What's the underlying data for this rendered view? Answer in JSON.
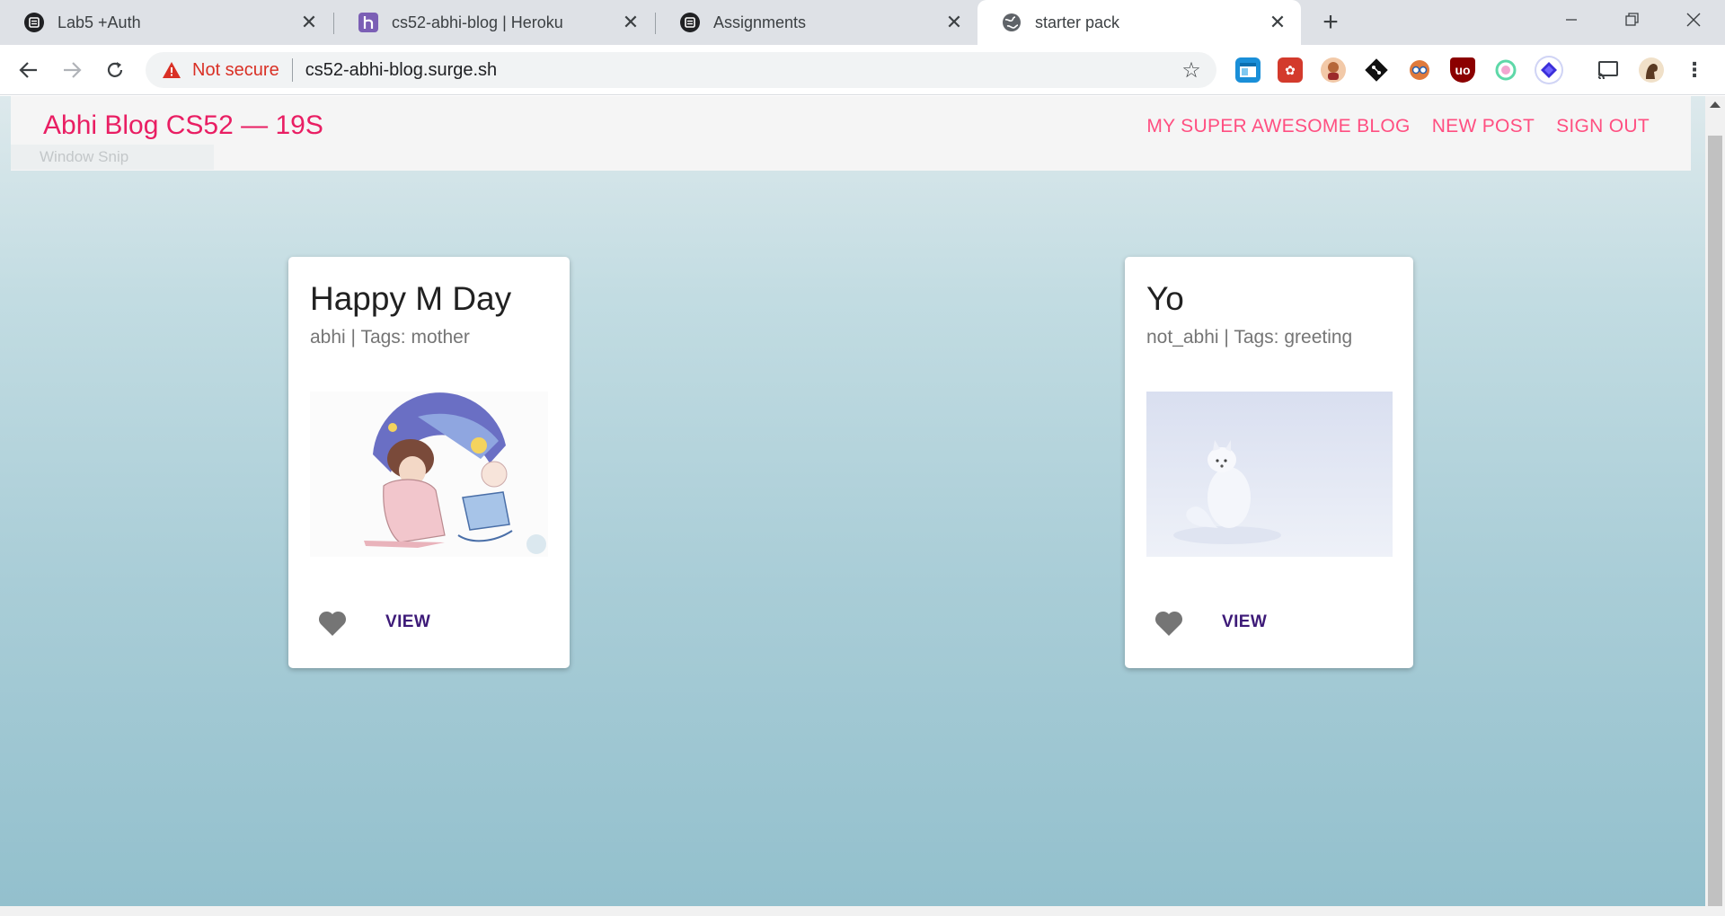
{
  "browser": {
    "tabs": [
      {
        "title": "Lab5 +Auth",
        "icon": "canvas-icon",
        "active": false
      },
      {
        "title": "cs52-abhi-blog | Heroku",
        "icon": "heroku-icon",
        "active": false
      },
      {
        "title": "Assignments",
        "icon": "canvas-icon",
        "active": false
      },
      {
        "title": "starter pack",
        "icon": "globe-icon",
        "active": true
      }
    ],
    "new_tab": "+",
    "security_label": "Not secure",
    "url": "cs52-abhi-blog.surge.sh"
  },
  "app": {
    "brand": "Abhi Blog CS52 — 19S",
    "nav": [
      "MY SUPER AWESOME BLOG",
      "NEW POST",
      "SIGN OUT"
    ],
    "overlay_label": "Window Snip"
  },
  "posts": [
    {
      "title": "Happy M Day",
      "meta": "abhi | Tags: mother",
      "image": "mother-baby-illustration",
      "action": "VIEW"
    },
    {
      "title": "Yo",
      "meta": "not_abhi | Tags: greeting",
      "image": "arctic-fox-photo",
      "action": "VIEW"
    }
  ],
  "colors": {
    "brand": "#e91e63",
    "nav_link": "#ff4f81",
    "view_button": "#3d1a78",
    "heart": "#757575"
  }
}
